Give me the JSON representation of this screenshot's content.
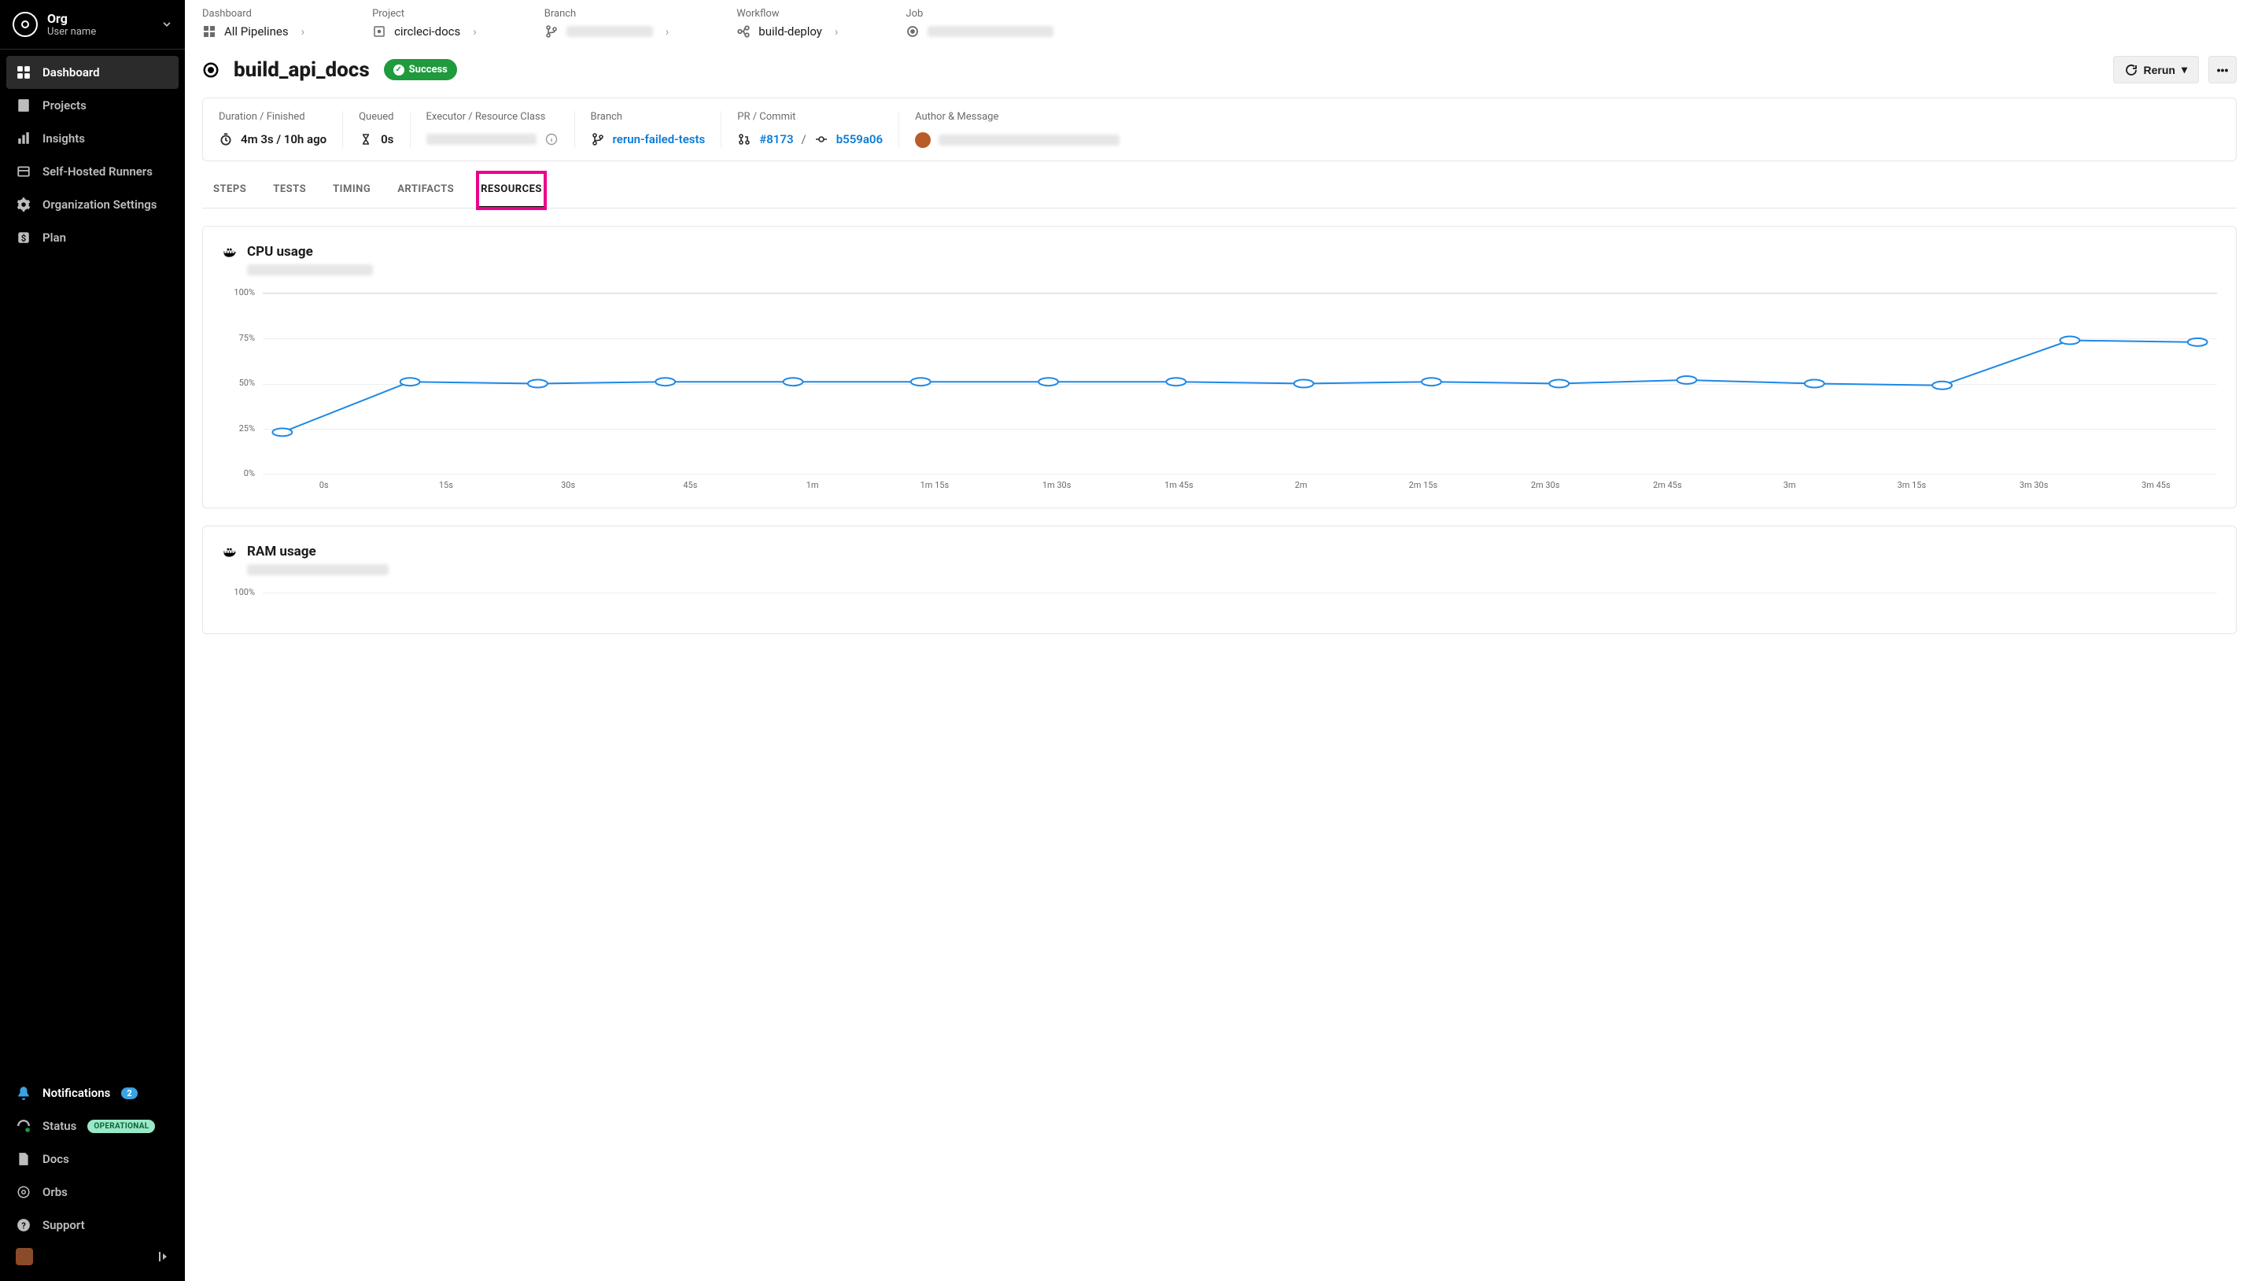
{
  "sidebar": {
    "org_name": "Org",
    "user_name": "User name",
    "top_items": [
      {
        "label": "Dashboard",
        "name": "dashboard"
      },
      {
        "label": "Projects",
        "name": "projects"
      },
      {
        "label": "Insights",
        "name": "insights"
      },
      {
        "label": "Self-Hosted Runners",
        "name": "runners"
      },
      {
        "label": "Organization Settings",
        "name": "org-settings"
      },
      {
        "label": "Plan",
        "name": "plan"
      }
    ],
    "notifications_label": "Notifications",
    "notifications_count": "2",
    "status_label": "Status",
    "status_value": "OPERATIONAL",
    "docs_label": "Docs",
    "orbs_label": "Orbs",
    "support_label": "Support"
  },
  "breadcrumb": {
    "dashboard_label": "Dashboard",
    "dashboard_value": "All Pipelines",
    "project_label": "Project",
    "project_value": "circleci-docs",
    "branch_label": "Branch",
    "workflow_label": "Workflow",
    "workflow_value": "build-deploy",
    "job_label": "Job"
  },
  "job": {
    "name": "build_api_docs",
    "status": "Success",
    "rerun_label": "Rerun"
  },
  "meta": {
    "duration_label": "Duration / Finished",
    "duration_value": "4m 3s / 10h ago",
    "queued_label": "Queued",
    "queued_value": "0s",
    "executor_label": "Executor / Resource Class",
    "branch_label": "Branch",
    "branch_value": "rerun-failed-tests",
    "pr_label": "PR / Commit",
    "pr_value": "#8173",
    "commit_value": "b559a06",
    "author_label": "Author & Message"
  },
  "tabs": {
    "steps": "STEPS",
    "tests": "TESTS",
    "timing": "TIMING",
    "artifacts": "ARTIFACTS",
    "resources": "RESOURCES"
  },
  "resources": {
    "cpu_title": "CPU usage",
    "ram_title": "RAM usage"
  },
  "chart_data": [
    {
      "type": "line",
      "title": "CPU usage",
      "ylabel": "%",
      "ylim": [
        0,
        100
      ],
      "y_ticks": [
        "100%",
        "75%",
        "50%",
        "25%",
        "0%"
      ],
      "categories": [
        "0s",
        "15s",
        "30s",
        "45s",
        "1m",
        "1m 15s",
        "1m 30s",
        "1m 45s",
        "2m",
        "2m 15s",
        "2m 30s",
        "2m 45s",
        "3m",
        "3m 15s",
        "3m 30s",
        "3m 45s"
      ],
      "series": [
        {
          "name": "cpu",
          "color": "#1e88e5",
          "values": [
            23,
            51,
            50,
            51,
            51,
            51,
            51,
            51,
            50,
            51,
            50,
            52,
            50,
            49,
            74,
            73
          ]
        }
      ]
    },
    {
      "type": "line",
      "title": "RAM usage",
      "ylabel": "%",
      "ylim": [
        0,
        100
      ],
      "y_ticks": [
        "100%"
      ],
      "categories": [],
      "series": []
    }
  ]
}
